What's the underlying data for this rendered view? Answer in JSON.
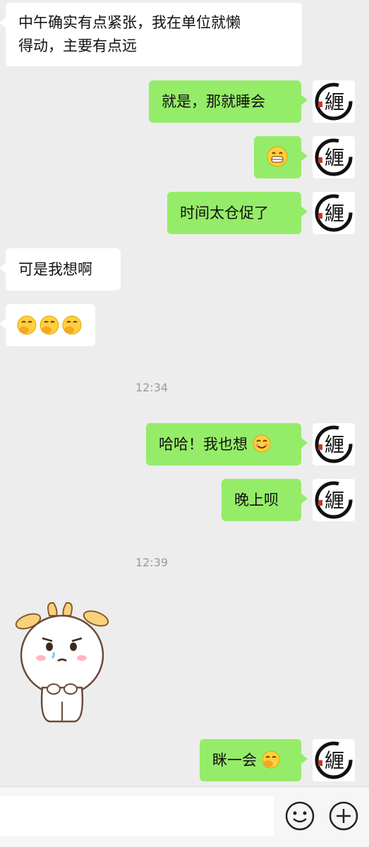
{
  "messages": {
    "m1": "中午确实有点紧张，我在单位就懒",
    "m1b": "得动，主要有点远",
    "m2": "就是，那就睡会",
    "m3_emoji": "grinning-face-emoji",
    "m4": "时间太仓促了",
    "m5": "可是我想啊",
    "m6_emoji": "hand-over-mouth-emoji",
    "m7": "哈哈！我也想",
    "m8": "晚上呗",
    "m9": "眯一会"
  },
  "timestamps": {
    "t1": "12:34",
    "t2": "12:39"
  },
  "avatar": {
    "glyph": "緾"
  },
  "colors": {
    "outgoing_bubble": "#95ec69",
    "incoming_bubble": "#ffffff",
    "background": "#ededed"
  }
}
